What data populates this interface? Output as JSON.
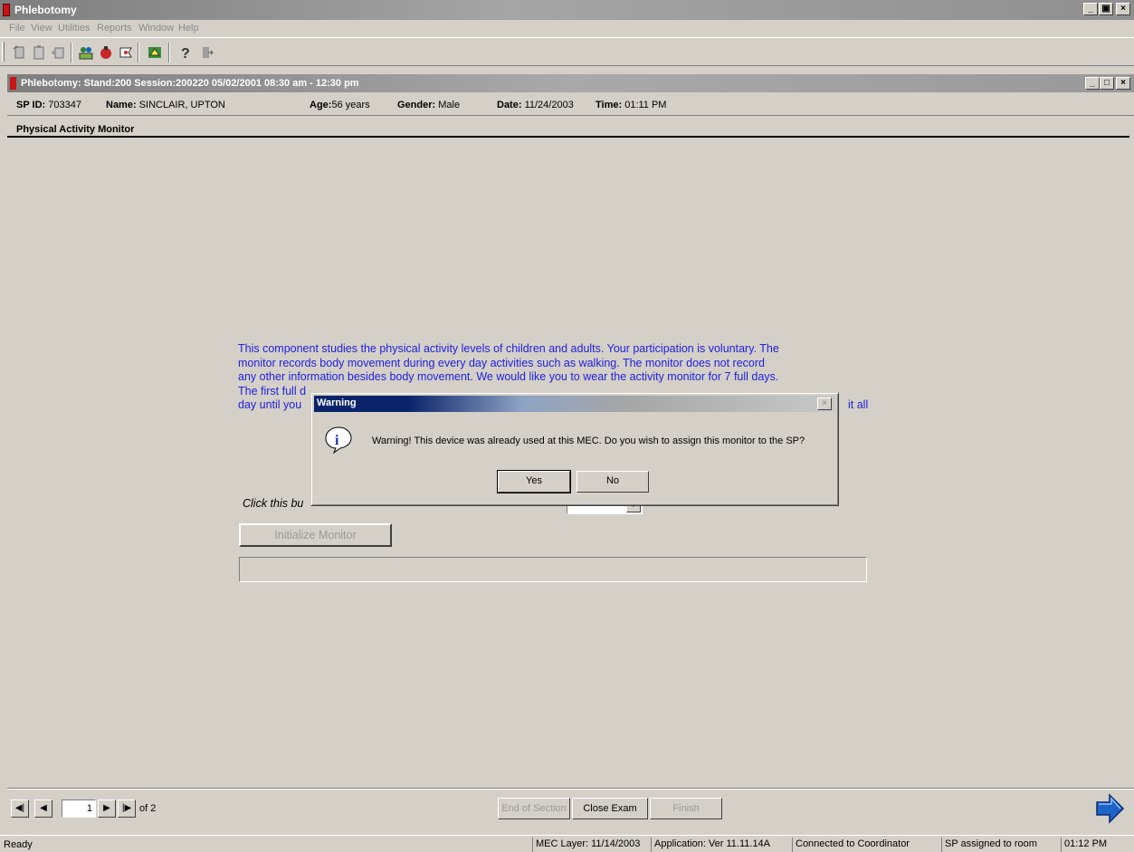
{
  "app": {
    "title": "Phlebotomy",
    "window_buttons": [
      "_",
      "̸",
      "×"
    ]
  },
  "menu": {
    "items": [
      "File",
      "View",
      "Utilities",
      "Reports",
      "Window",
      "Help"
    ]
  },
  "child_window": {
    "title": "Phlebotomy: Stand:200 Session:200220 05/02/2001 08:30 am - 12:30 pm"
  },
  "sp_info": {
    "sp_id_label": "SP ID:",
    "sp_id_value": "703347",
    "name_label": "Name:",
    "name_value": "SINCLAIR, UPTON",
    "age_label": "Age:",
    "age_value": "56 years",
    "gender_label": "Gender:",
    "gender_value": "Male",
    "date_label": "Date:",
    "date_value": "11/24/2003",
    "time_label": "Time:",
    "time_value": "01:11 PM"
  },
  "section": {
    "title": "Physical Activity Monitor"
  },
  "consent_lines": [
    "This component studies the physical activity levels of children and adults. Your participation is voluntary. The",
    "monitor records body movement during every day activities such as walking. The monitor does not record",
    "any other information besides body movement. We would like you to wear the activity monitor for 7 full days.",
    "The first full d",
    "day until you"
  ],
  "consent_tail": "it all",
  "form": {
    "click_label": "Click this bu",
    "initialize_button": "Initialize Monitor"
  },
  "dialog": {
    "title": "Warning",
    "close_glyph": "×",
    "message": "Warning! This device was already used at this MEC. Do you wish to assign this monitor to the SP?",
    "yes_label": "Yes",
    "no_label": "No"
  },
  "pager": {
    "current_page": "1",
    "of_label": "of 2"
  },
  "footer_buttons": {
    "end_of_section": "End of Section",
    "close_exam": "Close Exam",
    "finish": "Finish"
  },
  "status": {
    "ready": "Ready",
    "mec_layer": "MEC Layer: 11/14/2003",
    "application": "Application: Ver 11.11.14A",
    "connection": "Connected to Coordinator",
    "assignment": "SP assigned to room",
    "clock": "01:12 PM"
  },
  "colors": {
    "consent_text": "#2020e0",
    "dialog_title_active": "#0a246a",
    "next_arrow": "#1e64c8"
  }
}
